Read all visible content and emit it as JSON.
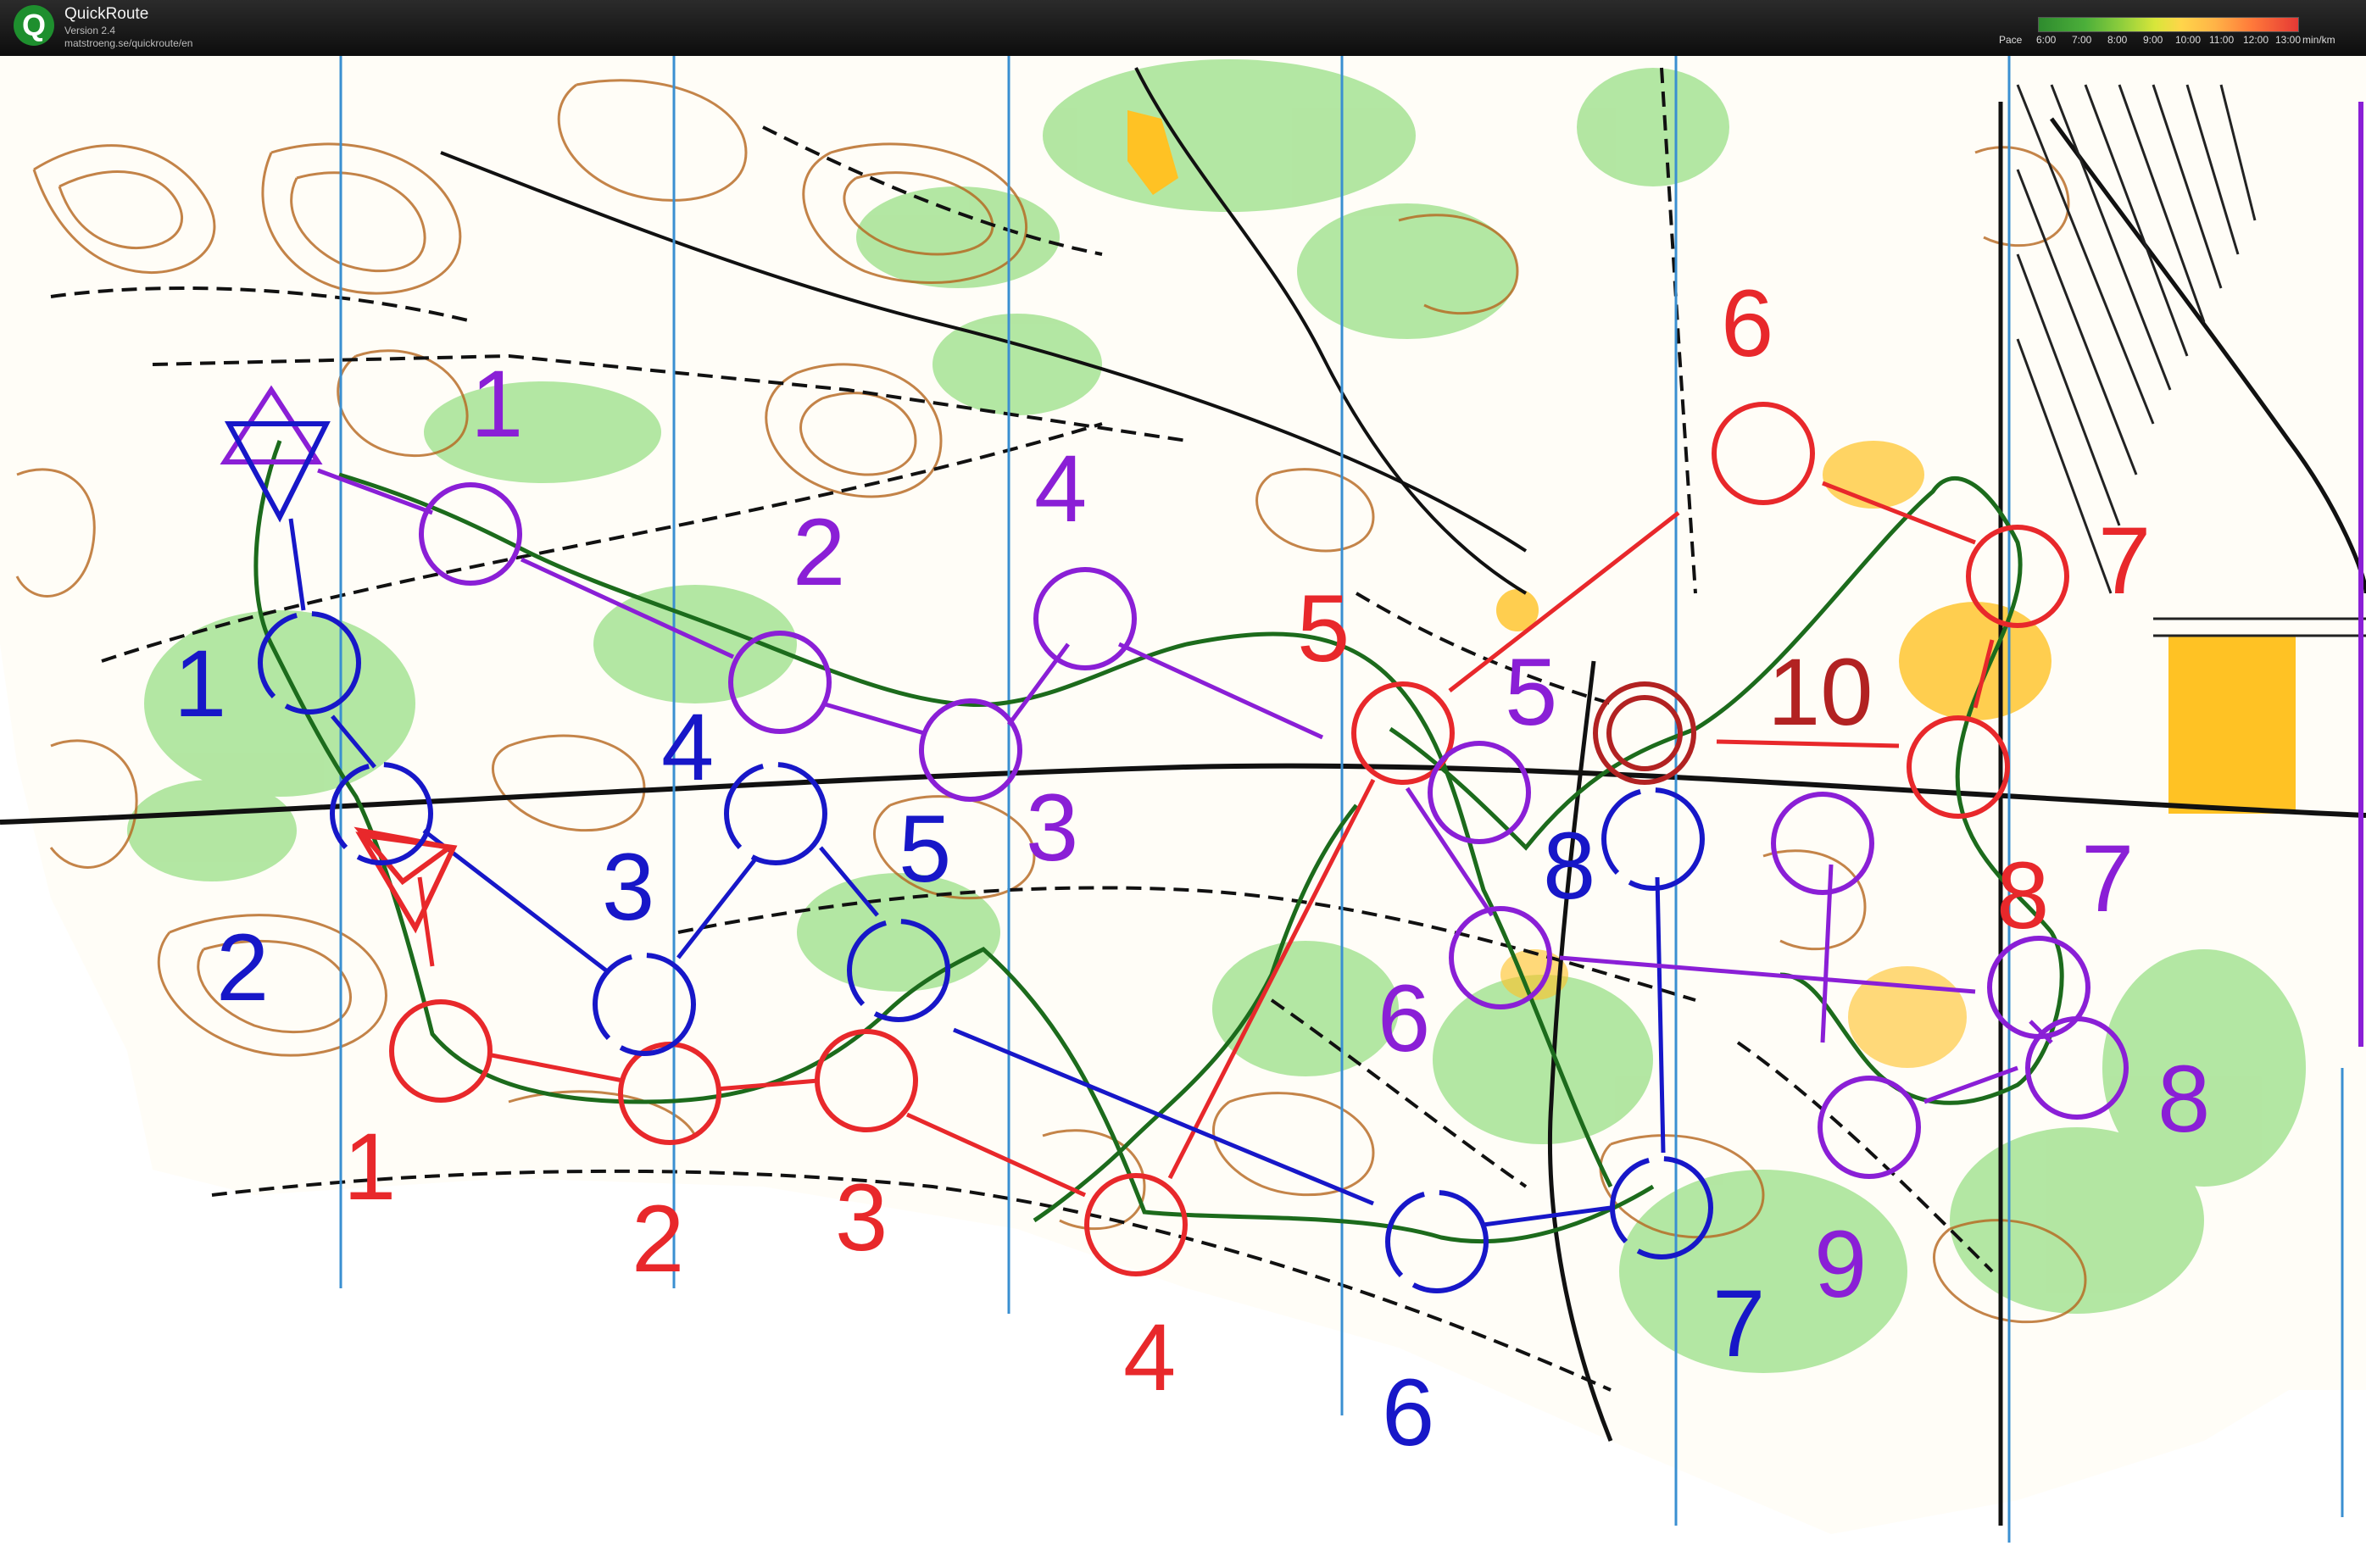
{
  "app": {
    "title": "QuickRoute",
    "version": "Version 2.4",
    "url": "matstroeng.se/quickroute/en"
  },
  "pace_legend": {
    "label": "Pace",
    "ticks": [
      "6:00",
      "7:00",
      "8:00",
      "9:00",
      "10:00",
      "11:00",
      "12:00",
      "13:00"
    ],
    "unit": "min/km"
  },
  "colors": {
    "red_course": "#e8282b",
    "blue_course": "#1717c8",
    "purple_course": "#8a1fd6",
    "route_line": "#1c6b1c",
    "contour": "#b5651d",
    "vegetation": "#9be08a",
    "open_land": "#ffc21f",
    "meridian": "#3a8fd1"
  },
  "courses": {
    "red_labels": [
      "1",
      "2",
      "3",
      "4",
      "5",
      "6",
      "7",
      "8",
      "10"
    ],
    "blue_labels": [
      "1",
      "2",
      "3",
      "4",
      "5",
      "6",
      "7",
      "8"
    ],
    "purple_labels": [
      "1",
      "2",
      "3",
      "4",
      "5",
      "6",
      "7",
      "8",
      "9"
    ]
  }
}
